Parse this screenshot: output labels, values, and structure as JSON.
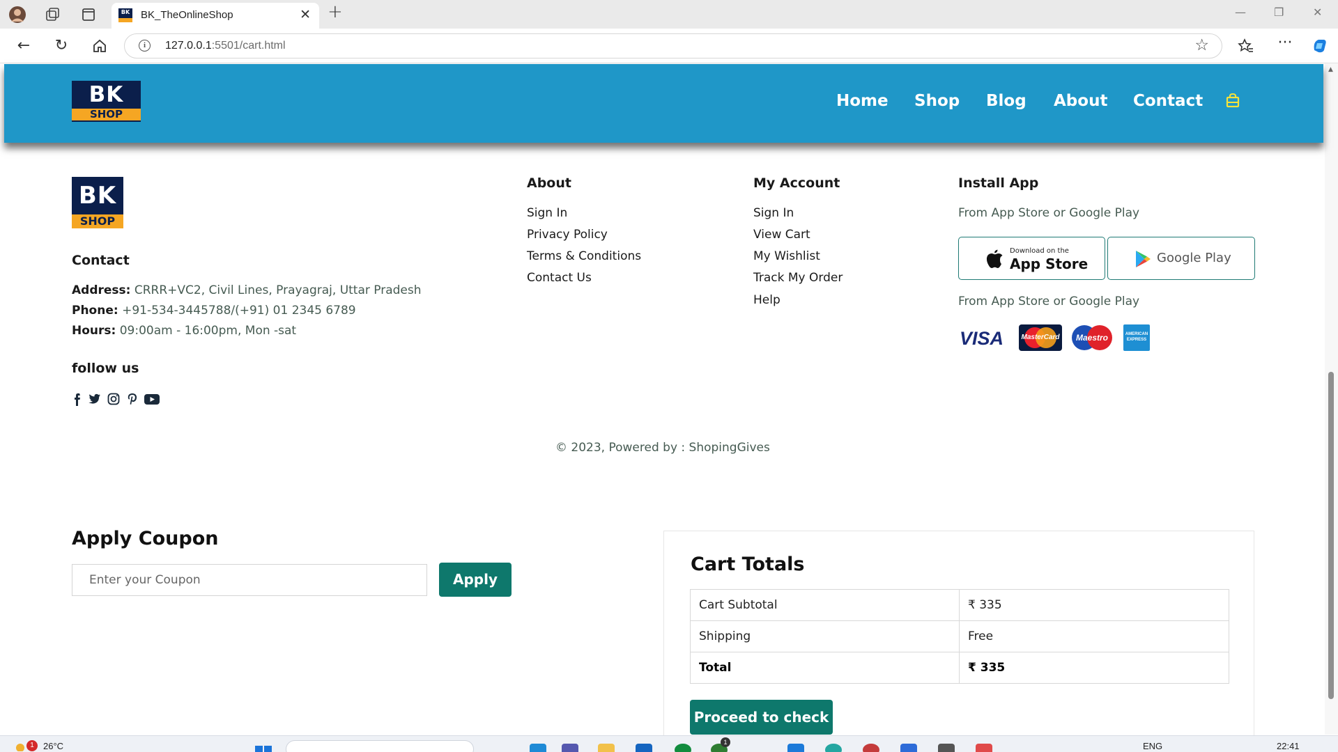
{
  "browser": {
    "tab_title": "BK_TheOnlineShop",
    "url_host": "127.0.0.1",
    "url_path": ":5501/cart.html"
  },
  "header": {
    "logo_top": "BK",
    "logo_bottom": "SHOP",
    "nav": [
      "Home",
      "Shop",
      "Blog",
      "About",
      "Contact"
    ]
  },
  "footer": {
    "logo_top": "BK",
    "logo_bottom": "SHOP",
    "contact": {
      "heading": "Contact",
      "address_label": "Address:",
      "address": "CRRR+VC2, Civil Lines, Prayagraj, Uttar Pradesh",
      "phone_label": "Phone:",
      "phone": "+91-534-3445788/(+91) 01 2345 6789",
      "hours_label": "Hours:",
      "hours": "09:00am - 16:00pm, Mon -sat"
    },
    "follow_heading": "follow us",
    "about": {
      "heading": "About",
      "links": [
        "Sign In",
        "Privacy Policy",
        "Terms & Conditions",
        "Contact Us"
      ]
    },
    "account": {
      "heading": "My Account",
      "links": [
        "Sign In",
        "View Cart",
        "My Wishlist",
        "Track My Order",
        "Help"
      ]
    },
    "install": {
      "heading": "Install App",
      "subtitle": "From App Store or Google Play",
      "appstore_small": "Download on the",
      "appstore_big": "App Store",
      "googleplay": "Google Play",
      "payment_subtitle": "From App Store or Google Play",
      "payments": [
        "VISA",
        "MasterCard",
        "Maestro",
        "AMERICAN EXPRESS"
      ]
    },
    "copyright": "© 2023, Powered by : ShopingGives"
  },
  "coupon": {
    "title": "Apply Coupon",
    "placeholder": "Enter your Coupon",
    "button": "Apply"
  },
  "totals": {
    "title": "Cart Totals",
    "rows": [
      {
        "label": "Cart Subtotal",
        "value": "₹ 335"
      },
      {
        "label": "Shipping",
        "value": "Free"
      },
      {
        "label": "Total",
        "value": "₹ 335"
      }
    ],
    "button": "Proceed to check"
  },
  "taskbar": {
    "weather_badge": "1",
    "temperature": "26°C",
    "language": "ENG",
    "time": "22:41",
    "notification_badge": "1"
  },
  "colors": {
    "header_bg": "#1f97c8",
    "brand_navy": "#0b1f4b",
    "brand_orange": "#f5a623",
    "button_teal": "#0e786c",
    "cart_icon": "#f7e33a"
  }
}
